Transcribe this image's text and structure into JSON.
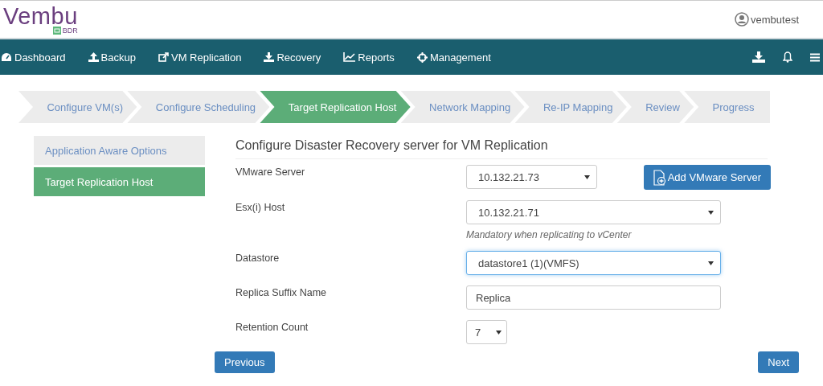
{
  "header": {
    "logo": "Vembu",
    "product": "BDR",
    "user": "vembutest"
  },
  "nav": [
    {
      "label": "Dashboard"
    },
    {
      "label": "Backup"
    },
    {
      "label": "VM Replication"
    },
    {
      "label": "Recovery"
    },
    {
      "label": "Reports"
    },
    {
      "label": "Management"
    }
  ],
  "steps": [
    {
      "label": "Configure VM(s)",
      "selected": false
    },
    {
      "label": "Configure Scheduling",
      "selected": false
    },
    {
      "label": "Target Replication Host",
      "selected": true
    },
    {
      "label": "Network Mapping",
      "selected": false
    },
    {
      "label": "Re-IP Mapping",
      "selected": false
    },
    {
      "label": "Review",
      "selected": false
    },
    {
      "label": "Progress",
      "selected": false
    }
  ],
  "sidebar": {
    "items": [
      {
        "label": "Application Aware Options",
        "selected": false
      },
      {
        "label": "Target Replication Host",
        "selected": true
      }
    ]
  },
  "form": {
    "title": "Configure Disaster Recovery server for VM Replication",
    "fields": [
      {
        "label": "VMware Server",
        "kind": "select-short",
        "value": "10.132.21.73",
        "focused": false,
        "button": "Add VMware Server"
      },
      {
        "label": "Esx(i) Host",
        "kind": "select",
        "value": "10.132.21.71",
        "focused": false,
        "hint": "Mandatory when replicating to vCenter"
      },
      {
        "label": "Datastore",
        "kind": "select",
        "value": "datastore1 (1)(VMFS)",
        "focused": true
      },
      {
        "label": "Replica Suffix Name",
        "kind": "text",
        "value": "Replica",
        "focused": false
      },
      {
        "label": "Retention Count",
        "kind": "select-tiny",
        "value": "7",
        "focused": false
      }
    ]
  },
  "buttons": {
    "previous": "Previous",
    "next": "Next"
  }
}
